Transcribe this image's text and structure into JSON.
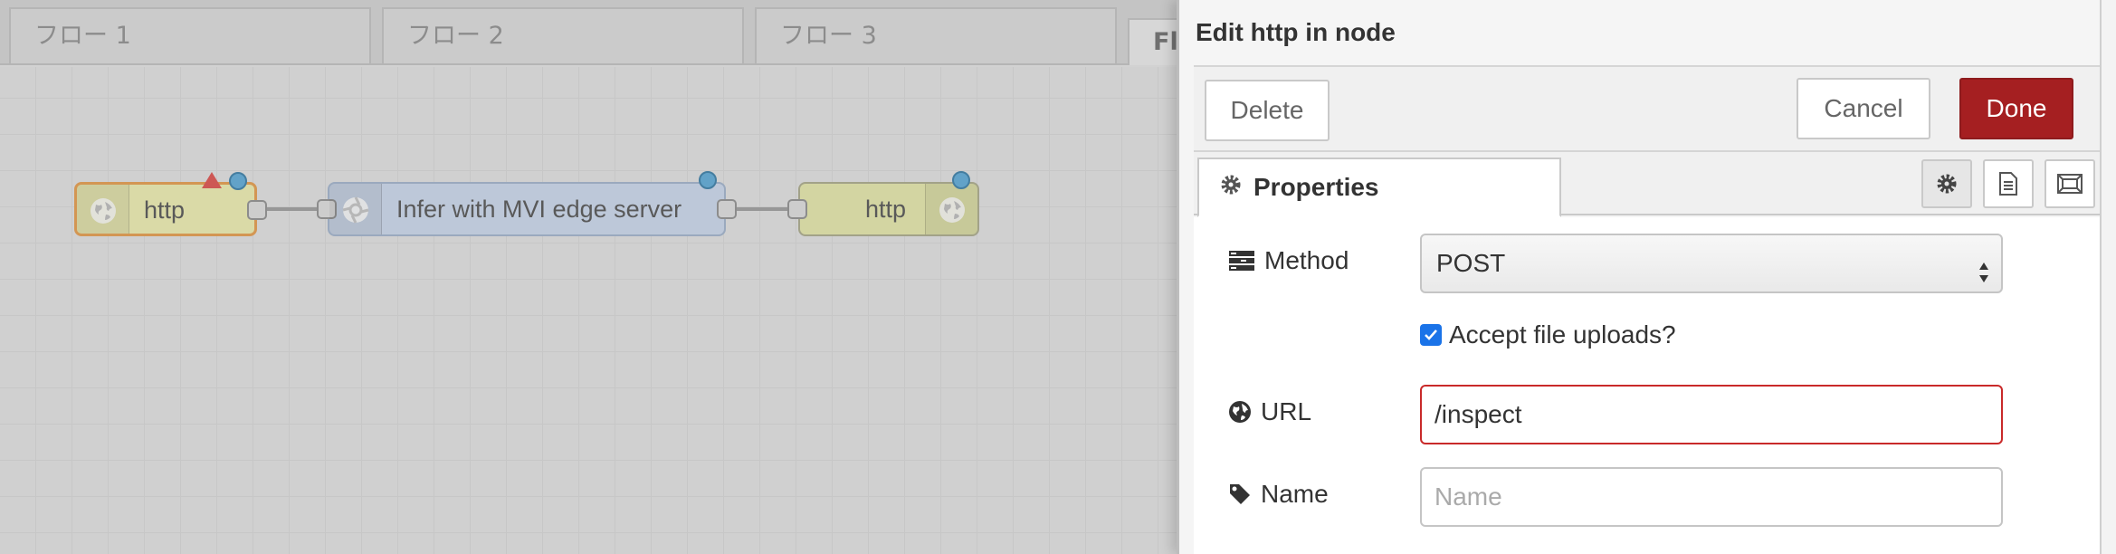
{
  "workspace": {
    "tabs": [
      {
        "label": "フロー 1"
      },
      {
        "label": "フロー 2"
      },
      {
        "label": "フロー 3"
      },
      {
        "label": "Flo"
      }
    ],
    "nodes": {
      "http_in": {
        "label": "http",
        "color": "#e7e7ae",
        "border": "#e09a4e"
      },
      "infer": {
        "label": "Infer with MVI edge server",
        "color": "#c7d3e6",
        "border": "#9fb0c8"
      },
      "http_out": {
        "label": "http",
        "color": "#e0e2a8",
        "border": "#a8a88a"
      }
    }
  },
  "panel": {
    "title": "Edit http in node",
    "delete_label": "Delete",
    "cancel_label": "Cancel",
    "done_label": "Done",
    "properties_tab": "Properties",
    "method": {
      "label": "Method",
      "value": "POST"
    },
    "accept_uploads": {
      "label": "Accept file uploads?",
      "checked": true
    },
    "url": {
      "label": "URL",
      "value": "/inspect"
    },
    "name": {
      "label": "Name",
      "value": "",
      "placeholder": "Name"
    }
  },
  "colors": {
    "done_button": "#a51f21",
    "invalid_border": "#c92a2a",
    "status_dot": "#5fa8d3",
    "warning": "#d9534f"
  }
}
